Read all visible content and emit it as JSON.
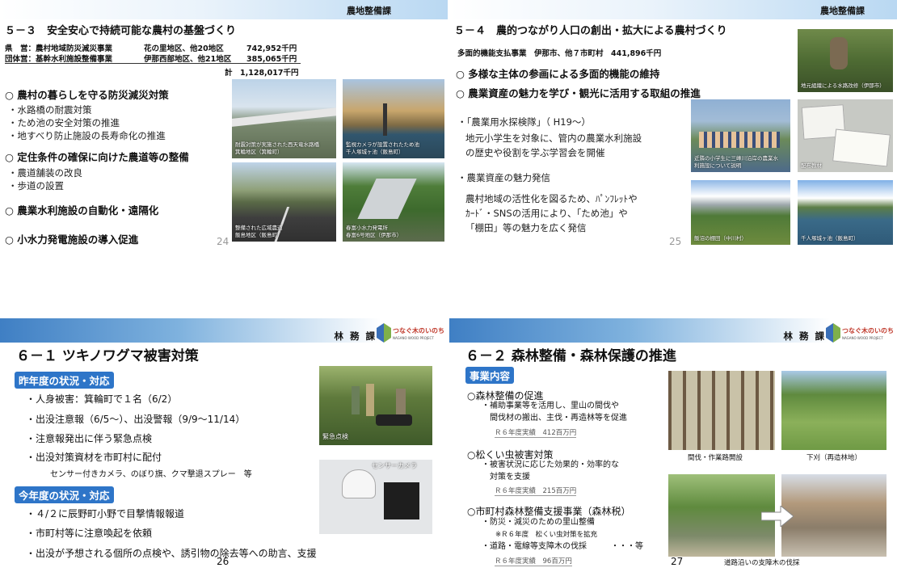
{
  "slide24": {
    "dept": "農地整備課",
    "title": "５－３　安全安心で持続可能な農村の基盤づくり",
    "budget_rows": [
      {
        "label": "県　営：農村地域防災減災事業",
        "area": "花の里地区、他20地区",
        "amount": "742,952千円"
      },
      {
        "label": "団体営：基幹水利施設整備事業",
        "area": "伊那西部地区、他21地区",
        "amount": "385,065千円"
      }
    ],
    "total": "計　1,128,017千円",
    "heading1": "○ 農村の暮らしを守る防災減災対策",
    "bullets1": [
      "・水路橋の耐震対策",
      "・ため池の安全対策の推進",
      "・地すべり防止施設の長寿命化の推進"
    ],
    "heading2": "○ 定住条件の確保に向けた農道等の整備",
    "bullets2": [
      "・農道舗装の改良",
      "・歩道の設置"
    ],
    "heading3": "○ 農業水利施設の自動化・遠隔化",
    "heading4": "○ 小水力発電施設の導入促進",
    "page": "24",
    "photos": [
      {
        "caption": "耐震対策が実施された西天竜水路橋\n箕輪地区（箕輪町）"
      },
      {
        "caption": "監視カメラが設置されたため池\n千人塚城ヶ池（飯島町）"
      },
      {
        "caption": "整備された広域農道\n飯島地区（飯島町）"
      },
      {
        "caption": "春富小水力発電所\n春富6号地区（伊那市）"
      }
    ]
  },
  "slide25": {
    "dept": "農地整備課",
    "title": "５－４　農的つながり人口の創出・拡大による農村づくり",
    "budget": "多面的機能支払事業　伊那市、他７市町村　441,896千円",
    "heading1": "○ 多様な主体の参画による多面的機能の維持",
    "heading2": "○ 農業資産の魅力を学び・観光に活用する取組の推進",
    "item1_title": "・「農業用水探検隊」（ H19～）",
    "item1_text": [
      "地元小学生を対象に、管内の農業水利施設",
      "の歴史や役割を学ぶ学習会を開催"
    ],
    "item2_title": "・農業資産の魅力発信",
    "item2_text": [
      "農村地域の活性化を図るため、ﾊﾟﾝﾌﾚｯﾄや",
      "ｶｰﾄﾞ・SNSの活用により、「ため池」や",
      "「棚田」等の魅力を広く発信"
    ],
    "page": "25",
    "photos": [
      {
        "caption": "地元組織による水路改修（伊那市）"
      },
      {
        "caption": "近隣の小学生に三峰川沿岸の農業水\n利施設について説明"
      },
      {
        "caption": "配布教材"
      },
      {
        "caption": "飯沼の棚田（中川村）"
      },
      {
        "caption": "千人塚城ヶ池（飯島町）"
      }
    ]
  },
  "slide26": {
    "dept": "林 務 課",
    "logo_text": "つなぐ木のいのち",
    "logo_sub": "NAGANO WOOD PROJECT",
    "title": "６－１ ツキノワグマ被害対策",
    "pill1": "昨年度の状況・対応",
    "bullets1": [
      "・人身被害：箕輪町で１名（6/2）",
      "・出没注意報（6/5～）、出没警報（9/9～11/14）",
      "・注意報発出に伴う緊急点検",
      "・出没対策資材を市町村に配付"
    ],
    "sub1": "センサー付きカメラ、のぼり旗、クマ撃退スプレー　等",
    "pill2": "今年度の状況・対応",
    "bullets2": [
      "・４/２に辰野町小野で目撃情報報道",
      "・市町村等に注意喚起を依頼",
      "・出没が予想される個所の点検や、誘引物の除去等への助言、支援"
    ],
    "photo1_caption": "緊急点検",
    "photo2_caption": "センサーカメラ",
    "page": "26"
  },
  "slide27": {
    "dept": "林 務 課",
    "logo_text": "つなぐ木のいのち",
    "logo_sub": "NAGANO WOOD PROJECT",
    "title": "６－２ 森林整備・森林保護の推進",
    "pill": "事業内容",
    "sections": [
      {
        "heading": "○森林整備の促進",
        "lines": [
          "・補助事業等を活用し、里山の間伐や",
          "　間伐材の搬出、主伐・再造林等を促進"
        ],
        "result": "Ｒ６年度実績　412百万円"
      },
      {
        "heading": "○松くい虫被害対策",
        "lines": [
          "・被害状況に応じた効果的・効率的な",
          "　対策を支援"
        ],
        "result": "Ｒ６年度実績　215百万円"
      },
      {
        "heading": "○市町村森林整備支援事業（森林税）",
        "lines": [
          "・防災・減災のための里山整備",
          "　　※Ｒ６年度　松くい虫対策を拡充",
          "・道路・電線等支障木の伐採　　　・・・等"
        ],
        "result": "Ｒ６年度実績　96百万円"
      }
    ],
    "photo_captions": [
      "間伐・作業路開設",
      "下刈（再造林地）",
      "道路沿いの支障木の伐採"
    ],
    "page": "27"
  }
}
